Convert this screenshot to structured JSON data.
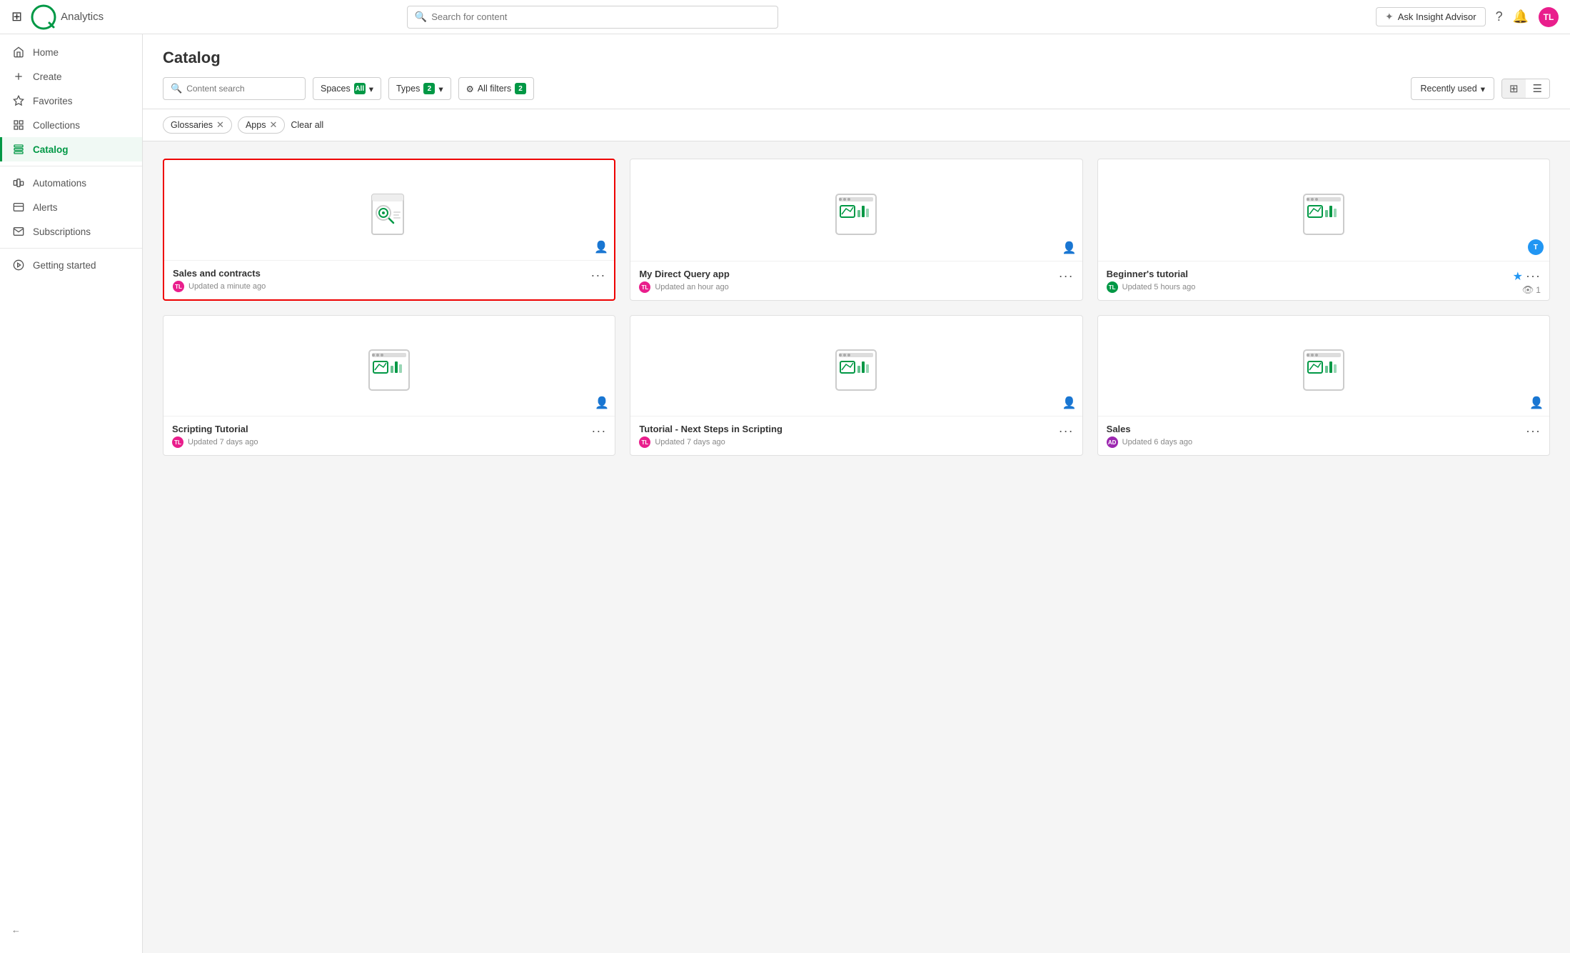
{
  "topnav": {
    "app_name": "Analytics",
    "search_placeholder": "Search for content",
    "insight_advisor_label": "Ask Insight Advisor",
    "avatar_initials": "TL",
    "avatar_color": "#e91e8c"
  },
  "sidebar": {
    "items": [
      {
        "id": "home",
        "label": "Home",
        "icon": "🏠"
      },
      {
        "id": "create",
        "label": "Create",
        "icon": "+"
      },
      {
        "id": "favorites",
        "label": "Favorites",
        "icon": "☆"
      },
      {
        "id": "collections",
        "label": "Collections",
        "icon": "⊞"
      },
      {
        "id": "catalog",
        "label": "Catalog",
        "icon": "📋",
        "active": true
      },
      {
        "id": "automations",
        "label": "Automations",
        "icon": "⚙"
      },
      {
        "id": "alerts",
        "label": "Alerts",
        "icon": "🔔"
      },
      {
        "id": "subscriptions",
        "label": "Subscriptions",
        "icon": "✉"
      },
      {
        "id": "getting-started",
        "label": "Getting started",
        "icon": "🚀"
      }
    ],
    "collapse_label": "←"
  },
  "catalog": {
    "title": "Catalog",
    "filters": {
      "search_placeholder": "Content search",
      "spaces_label": "Spaces",
      "spaces_value": "All",
      "types_label": "Types",
      "types_count": 2,
      "all_filters_label": "All filters",
      "all_filters_count": 2,
      "sort_label": "Recently used",
      "active_filter_1": "Glossaries",
      "active_filter_2": "Apps",
      "clear_all": "Clear all"
    },
    "cards": [
      {
        "id": "sales-contracts",
        "title": "Sales and contracts",
        "meta": "Updated a minute ago",
        "avatar_initials": "TL",
        "avatar_color": "#e91e8c",
        "owner_type": "person",
        "selected": true,
        "icon_type": "glossary",
        "starred": false
      },
      {
        "id": "my-direct-query",
        "title": "My Direct Query app",
        "meta": "Updated an hour ago",
        "avatar_initials": "TL",
        "avatar_color": "#e91e8c",
        "owner_type": "person",
        "selected": false,
        "icon_type": "app",
        "starred": false
      },
      {
        "id": "beginners-tutorial",
        "title": "Beginner's tutorial",
        "meta": "Updated 5 hours ago",
        "avatar_initials": "TL",
        "avatar_color": "#009845",
        "owner_type": "avatar",
        "owner_color": "#2196f3",
        "selected": false,
        "icon_type": "app",
        "starred": true,
        "viewers": 1
      },
      {
        "id": "scripting-tutorial",
        "title": "Scripting Tutorial",
        "meta": "Updated 7 days ago",
        "avatar_initials": "TL",
        "avatar_color": "#e91e8c",
        "owner_type": "person",
        "selected": false,
        "icon_type": "app",
        "starred": false
      },
      {
        "id": "tutorial-next-steps",
        "title": "Tutorial - Next Steps in Scripting",
        "meta": "Updated 7 days ago",
        "avatar_initials": "TL",
        "avatar_color": "#e91e8c",
        "owner_type": "person",
        "selected": false,
        "icon_type": "app",
        "starred": false
      },
      {
        "id": "sales",
        "title": "Sales",
        "meta": "Updated 6 days ago",
        "avatar_initials": "AD",
        "avatar_color": "#9c27b0",
        "owner_type": "person",
        "selected": false,
        "icon_type": "app",
        "starred": false
      }
    ]
  }
}
